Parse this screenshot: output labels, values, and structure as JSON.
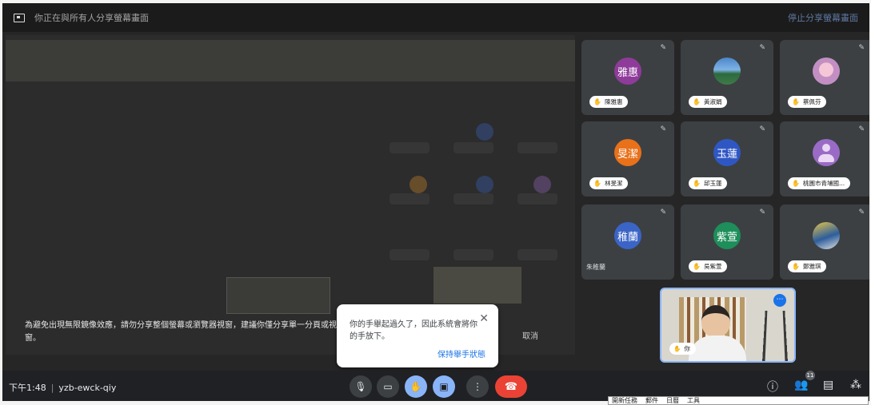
{
  "topbar": {
    "sharing_message": "你正在與所有人分享螢幕畫面",
    "stop_label": "停止分享螢幕畫面"
  },
  "notice": {
    "text": "為避免出現無限鏡像效應，請勿分享整個螢幕或瀏覽器視窗，建議你僅分享單一分頁或視窗。",
    "cancel_label": "取消"
  },
  "participants": [
    {
      "avatar": "雅惠",
      "name": "陳雅惠",
      "hand": true
    },
    {
      "avatar": "",
      "name": "黃淑娟",
      "hand": true
    },
    {
      "avatar": "",
      "name": "蔡佩芬",
      "hand": true
    },
    {
      "avatar": "旻潔",
      "name": "林旻潔",
      "hand": true
    },
    {
      "avatar": "玉蓮",
      "name": "邱玉蓮",
      "hand": true
    },
    {
      "avatar": "",
      "name": "桃園市青埔國...",
      "hand": true
    },
    {
      "avatar": "稚蘭",
      "name": "朱稚蘭",
      "hand": false
    },
    {
      "avatar": "紫萱",
      "name": "吳紫萱",
      "hand": true
    },
    {
      "avatar": "",
      "name": "鄭雅琪",
      "hand": true
    }
  ],
  "self_view": {
    "label": "你"
  },
  "popup": {
    "message": "你的手舉起過久了，因此系統會將你的手放下。",
    "keep_label": "保持舉手狀態",
    "close_icon": "✕"
  },
  "bottombar": {
    "time": "下午1:48",
    "meeting_code": "yzb-ewck-qiy",
    "participant_count": "11"
  },
  "taskbar": {
    "items": [
      "開新任務",
      "郵件",
      "日曆",
      "工具"
    ]
  }
}
